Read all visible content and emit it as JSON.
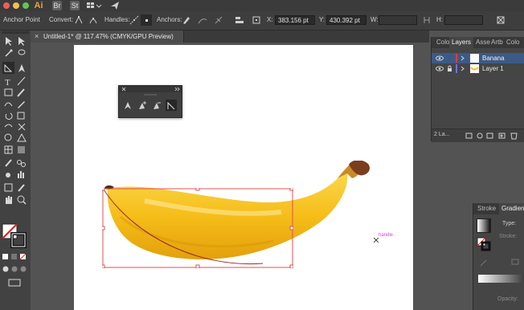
{
  "app": {
    "logo": "Ai",
    "bridge_label": "Br",
    "stock_label": "St"
  },
  "controlbar": {
    "tool_name": "Anchor Point",
    "convert_label": "Convert:",
    "handles_label": "Handles:",
    "anchors_label": "Anchors:",
    "x_label": "X:",
    "x_value": "383.156 pt",
    "y_label": "Y:",
    "y_value": "430.392 pt",
    "w_label": "W:",
    "h_label": "H:"
  },
  "document": {
    "tab_title": "Untitled-1* @ 117.47% (CMYK/GPU Preview)",
    "close_glyph": "×"
  },
  "canvas": {
    "hover_label": "handle",
    "hover_color": "#e040e0",
    "selection_color": "#e05050"
  },
  "layers_panel": {
    "tabs": [
      "Colo",
      "Layers",
      "Asse",
      "Artb",
      "Colo"
    ],
    "active_tab": "Layers",
    "layers": [
      {
        "name": "Banana",
        "color": "#e23a3a",
        "selected": true
      },
      {
        "name": "Layer 1",
        "color": "#6f6ff2",
        "selected": false
      }
    ],
    "footer_count": "2 La..."
  },
  "gradient_panel": {
    "tabs": [
      "Stroke",
      "Gradien"
    ],
    "type_label": "Type:",
    "stroke_label": "Stroke:",
    "opacity_label": "Opacity:"
  },
  "colors": {
    "accent_blue": "#2d6ee0",
    "banana_yellow": "#f7c21d",
    "banana_stem": "#8a4b22"
  },
  "icons": {
    "convert": [
      "convert-corner-icon",
      "convert-smooth-icon"
    ],
    "handles": [
      "show-handles-icon",
      "hide-handles-icon"
    ],
    "anchors": [
      "remove-anchor-icon",
      "connect-icon",
      "cut-path-icon"
    ]
  }
}
